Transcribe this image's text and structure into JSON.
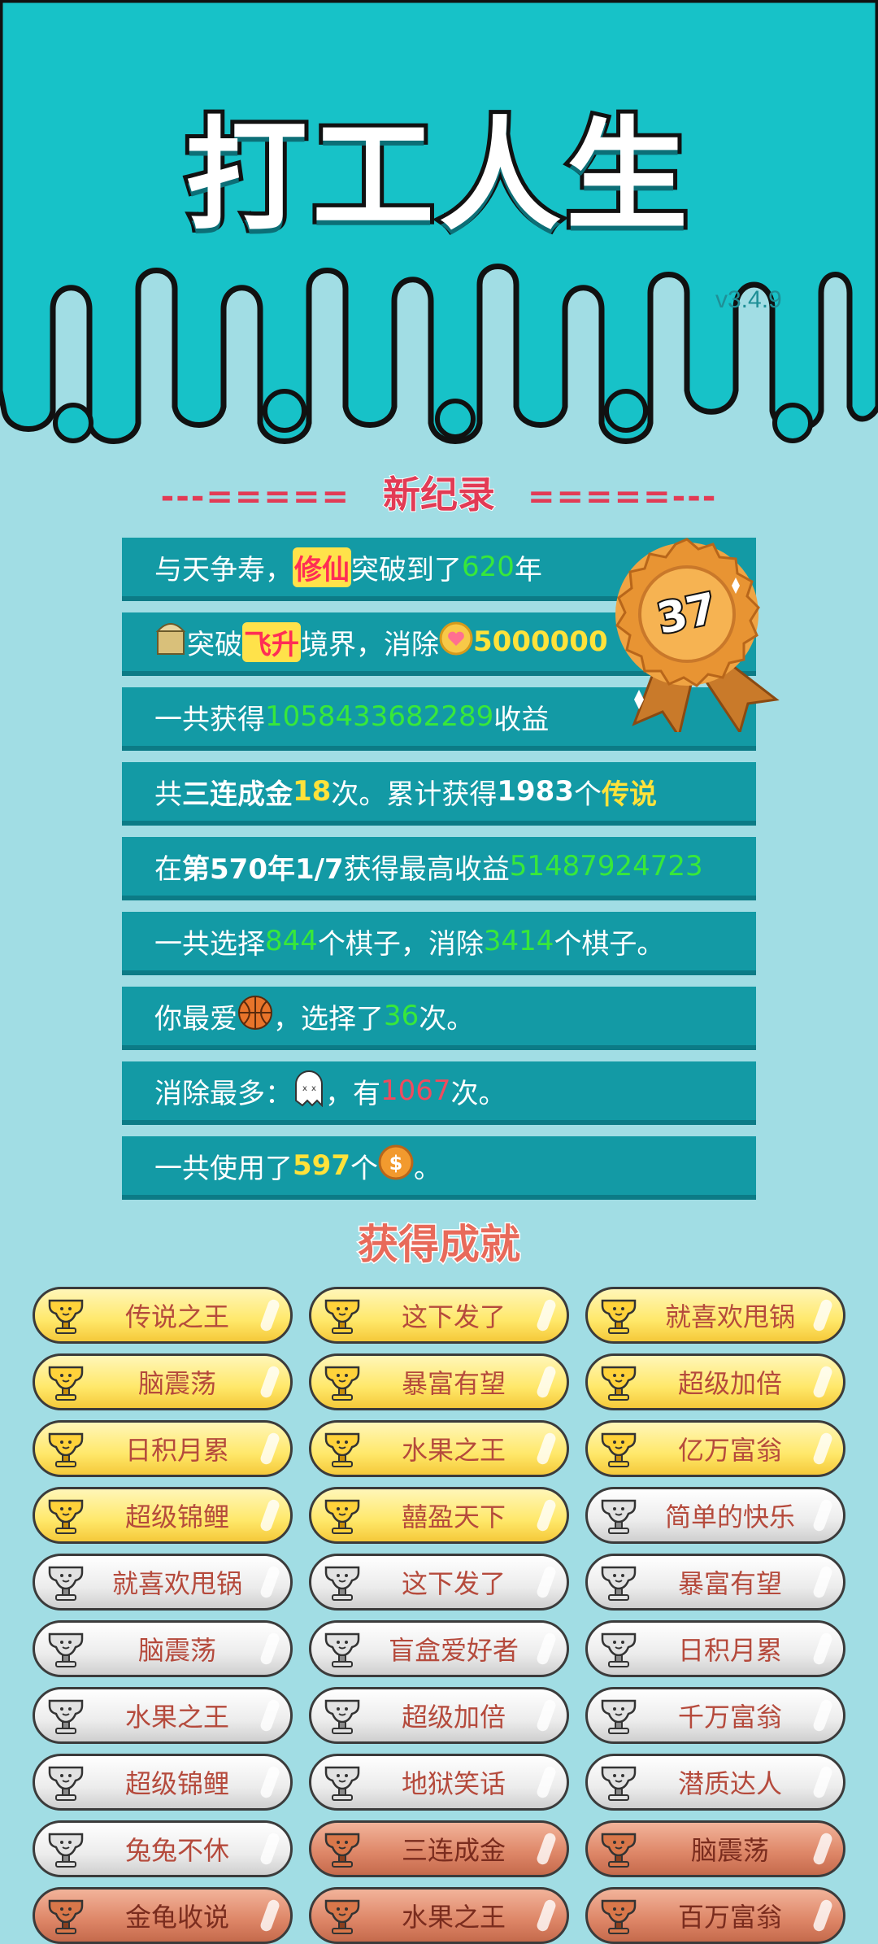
{
  "header": {
    "title": "打工人生",
    "version": "v3.4.9"
  },
  "record": {
    "dash_left": "---=====",
    "title": "新纪录",
    "dash_right": "=====---",
    "medal_number": "37",
    "rows": [
      {
        "parts": [
          {
            "t": "与天争寿，"
          },
          {
            "t": "修仙",
            "c": "pink-tag"
          },
          {
            "t": "突破到了"
          },
          {
            "t": "620",
            "c": "g"
          },
          {
            "t": "年"
          }
        ]
      },
      {
        "parts": [
          {
            "icon": "bucket"
          },
          {
            "t": "突破"
          },
          {
            "t": "飞升",
            "c": "pink-tag"
          },
          {
            "t": "境界，消除"
          },
          {
            "icon": "heart-coin"
          },
          {
            "t": "5000000",
            "c": "yellow-b"
          }
        ]
      },
      {
        "parts": [
          {
            "t": "一共获得"
          },
          {
            "t": "1058433682289",
            "c": "g"
          },
          {
            "t": "收益"
          }
        ]
      },
      {
        "parts": [
          {
            "t": "共"
          },
          {
            "t": "三连成金",
            "c": "b"
          },
          {
            "t": "18",
            "c": "y"
          },
          {
            "t": "次。累计获得"
          },
          {
            "t": "1983",
            "c": "b"
          },
          {
            "t": "个"
          },
          {
            "t": "传说",
            "c": "y"
          }
        ]
      },
      {
        "parts": [
          {
            "t": "在 "
          },
          {
            "t": "第570年1/7",
            "c": "b"
          },
          {
            "t": " 获得最高收益"
          },
          {
            "t": "51487924723",
            "c": "g"
          }
        ]
      },
      {
        "parts": [
          {
            "t": "一共选择"
          },
          {
            "t": "844",
            "c": "g"
          },
          {
            "t": "个棋子，消除"
          },
          {
            "t": "3414",
            "c": "g"
          },
          {
            "t": "个棋子。"
          }
        ]
      },
      {
        "parts": [
          {
            "t": "你最爱"
          },
          {
            "icon": "basketball"
          },
          {
            "t": "，选择了"
          },
          {
            "t": "36",
            "c": "g"
          },
          {
            "t": "次。"
          }
        ]
      },
      {
        "parts": [
          {
            "t": "消除最多："
          },
          {
            "icon": "ghost"
          },
          {
            "t": "，有"
          },
          {
            "t": "1067",
            "c": "r"
          },
          {
            "t": "次。"
          }
        ]
      },
      {
        "parts": [
          {
            "t": "一共使用了"
          },
          {
            "t": "597",
            "c": "y"
          },
          {
            "t": "个"
          },
          {
            "icon": "dollar-coin"
          },
          {
            "t": "。"
          }
        ]
      }
    ]
  },
  "achievements": {
    "title": "获得成就",
    "items": [
      {
        "label": "传说之王",
        "tier": "gold"
      },
      {
        "label": "这下发了",
        "tier": "gold"
      },
      {
        "label": "就喜欢甩锅",
        "tier": "gold"
      },
      {
        "label": "脑震荡",
        "tier": "gold"
      },
      {
        "label": "暴富有望",
        "tier": "gold"
      },
      {
        "label": "超级加倍",
        "tier": "gold"
      },
      {
        "label": "日积月累",
        "tier": "gold"
      },
      {
        "label": "水果之王",
        "tier": "gold"
      },
      {
        "label": "亿万富翁",
        "tier": "gold"
      },
      {
        "label": "超级锦鲤",
        "tier": "gold"
      },
      {
        "label": "囍盈天下",
        "tier": "gold"
      },
      {
        "label": "简单的快乐",
        "tier": "silver"
      },
      {
        "label": "就喜欢甩锅",
        "tier": "silver"
      },
      {
        "label": "这下发了",
        "tier": "silver"
      },
      {
        "label": "暴富有望",
        "tier": "silver"
      },
      {
        "label": "脑震荡",
        "tier": "silver"
      },
      {
        "label": "盲盒爱好者",
        "tier": "silver"
      },
      {
        "label": "日积月累",
        "tier": "silver"
      },
      {
        "label": "水果之王",
        "tier": "silver"
      },
      {
        "label": "超级加倍",
        "tier": "silver"
      },
      {
        "label": "千万富翁",
        "tier": "silver"
      },
      {
        "label": "超级锦鲤",
        "tier": "silver"
      },
      {
        "label": "地狱笑话",
        "tier": "silver"
      },
      {
        "label": "潜质达人",
        "tier": "silver"
      },
      {
        "label": "兔兔不休",
        "tier": "silver"
      },
      {
        "label": "三连成金",
        "tier": "bronze"
      },
      {
        "label": "脑震荡",
        "tier": "bronze"
      },
      {
        "label": "金龟收说",
        "tier": "bronze"
      },
      {
        "label": "水果之王",
        "tier": "bronze"
      },
      {
        "label": "百万富翁",
        "tier": "bronze"
      }
    ]
  },
  "colors": {
    "bg": "#a1dde4",
    "band": "#17c2c8",
    "row": "#139aa5",
    "green": "#38e83a",
    "yellow": "#ffe23a",
    "pink": "#ff2d55"
  },
  "icons": {
    "bucket": "bucket-icon",
    "heart-coin": "heart-coin-icon",
    "basketball": "basketball-icon",
    "ghost": "ghost-icon",
    "dollar-coin": "dollar-coin-icon",
    "cup": "trophy-icon"
  }
}
